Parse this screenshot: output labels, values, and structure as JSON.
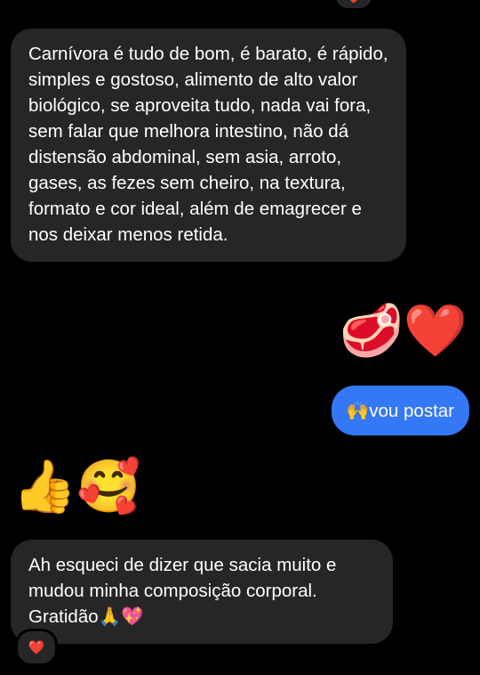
{
  "messages": {
    "m1_text": "Carnívora é tudo de bom, é barato, é rápido, simples e gostoso, alimento de alto valor biológico, se aproveita tudo, nada vai fora, sem falar que melhora intestino, não dá distensão abdominal, sem asia, arroto, gases, as fezes sem cheiro, na textura, formato e cor ideal, além de emagrecer e nos deixar menos retida.",
    "m2_emojis": "🥩❤️",
    "m3_text": "🙌vou postar",
    "m4_emojis": "👍🥰",
    "m5_text": "Ah esqueci de dizer que sacia muito e mudou minha composição corporal. Gratidão🙏💖"
  },
  "reactions": {
    "top": "❤️",
    "bottom": "❤️"
  },
  "colors": {
    "incoming_bubble": "#262628",
    "outgoing_bubble": "#3478f6",
    "background": "#000000"
  }
}
